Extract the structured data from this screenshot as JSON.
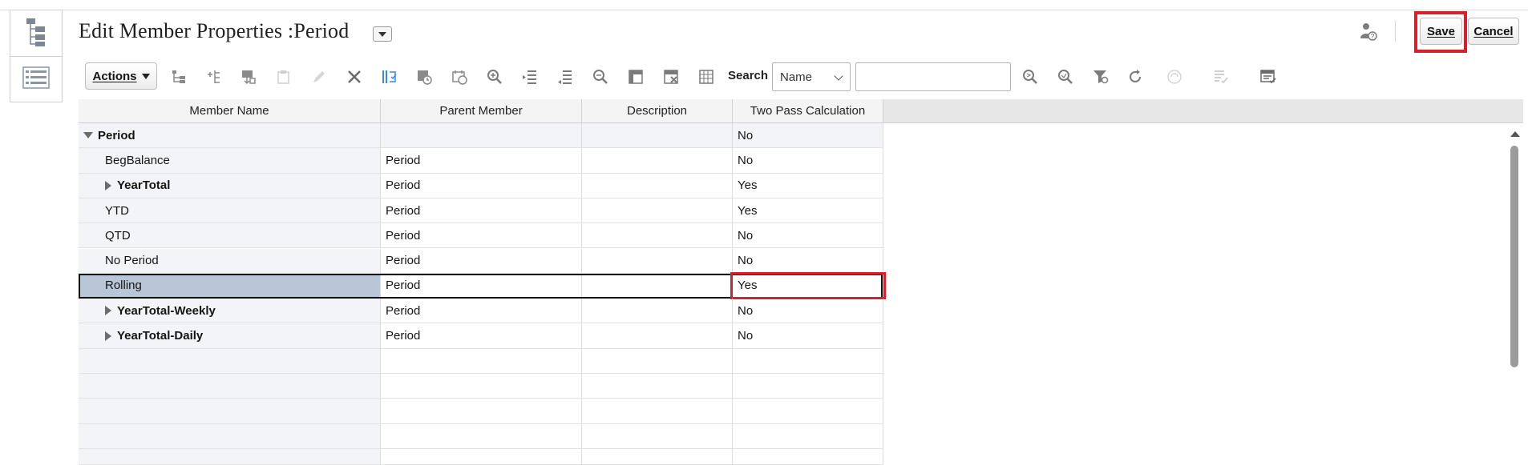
{
  "page": {
    "title": "Edit Member Properties :Period"
  },
  "header": {
    "save_label": "Save",
    "cancel_label": "Cancel"
  },
  "toolbar": {
    "actions_label": "Actions",
    "search_label": "Search",
    "search_field": "Name",
    "search_value": ""
  },
  "grid": {
    "columns": [
      "Member Name",
      "Parent Member",
      "Description",
      "Two Pass Calculation"
    ],
    "rows": [
      {
        "name": "Period",
        "parent": "",
        "description": "",
        "two_pass": "No"
      },
      {
        "name": "BegBalance",
        "parent": "Period",
        "description": "",
        "two_pass": "No"
      },
      {
        "name": "YearTotal",
        "parent": "Period",
        "description": "",
        "two_pass": "Yes"
      },
      {
        "name": "YTD",
        "parent": "Period",
        "description": "",
        "two_pass": "Yes"
      },
      {
        "name": "QTD",
        "parent": "Period",
        "description": "",
        "two_pass": "No"
      },
      {
        "name": "No Period",
        "parent": "Period",
        "description": "",
        "two_pass": "No"
      },
      {
        "name": "Rolling",
        "parent": "Period",
        "description": "",
        "two_pass": "Yes"
      },
      {
        "name": "YearTotal-Weekly",
        "parent": "Period",
        "description": "",
        "two_pass": "No"
      },
      {
        "name": "YearTotal-Daily",
        "parent": "Period",
        "description": "",
        "two_pass": "No"
      }
    ]
  },
  "colors": {
    "highlight_red": "#d4212b",
    "selected_row": "#b8c6d8"
  }
}
